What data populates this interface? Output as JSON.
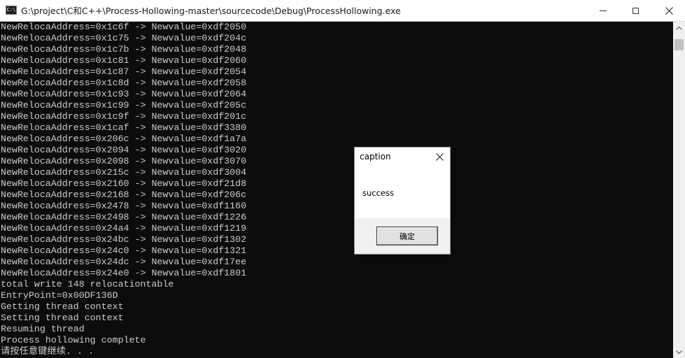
{
  "window": {
    "title": "G:\\project\\C和C++\\Process-Hollowing-master\\sourcecode\\Debug\\ProcessHollowing.exe",
    "icon": "console-app-icon",
    "icon_text": "C:\\"
  },
  "console": {
    "lines": [
      "NewRelocaAddress=0x1c6f -> Newvalue=0xdf2050",
      "NewRelocaAddress=0x1c75 -> Newvalue=0xdf204c",
      "NewRelocaAddress=0x1c7b -> Newvalue=0xdf2048",
      "NewRelocaAddress=0x1c81 -> Newvalue=0xdf2060",
      "NewRelocaAddress=0x1c87 -> Newvalue=0xdf2054",
      "NewRelocaAddress=0x1c8d -> Newvalue=0xdf2058",
      "NewRelocaAddress=0x1c93 -> Newvalue=0xdf2064",
      "NewRelocaAddress=0x1c99 -> Newvalue=0xdf205c",
      "NewRelocaAddress=0x1c9f -> Newvalue=0xdf201c",
      "NewRelocaAddress=0x1caf -> Newvalue=0xdf3380",
      "NewRelocaAddress=0x206c -> Newvalue=0xdf1a7a",
      "NewRelocaAddress=0x2094 -> Newvalue=0xdf3020",
      "NewRelocaAddress=0x2098 -> Newvalue=0xdf3070",
      "NewRelocaAddress=0x215c -> Newvalue=0xdf3004",
      "NewRelocaAddress=0x2160 -> Newvalue=0xdf21d8",
      "NewRelocaAddress=0x2168 -> Newvalue=0xdf206c",
      "NewRelocaAddress=0x2478 -> Newvalue=0xdf1160",
      "NewRelocaAddress=0x2498 -> Newvalue=0xdf1226",
      "NewRelocaAddress=0x24a4 -> Newvalue=0xdf1219",
      "NewRelocaAddress=0x24bc -> Newvalue=0xdf1302",
      "NewRelocaAddress=0x24c0 -> Newvalue=0xdf1321",
      "NewRelocaAddress=0x24dc -> Newvalue=0xdf17ee",
      "NewRelocaAddress=0x24e0 -> Newvalue=0xdf1801",
      "total write 148 relocationtable",
      "EntryPoint=0x00DF136D",
      "Getting thread context",
      "Setting thread context",
      "Resuming thread",
      "Process hollowing complete",
      "请按任意键继续. . ."
    ]
  },
  "dialog": {
    "caption": "caption",
    "message": "success",
    "ok_label": "确定"
  },
  "colors": {
    "console_bg": "#0c0c0c",
    "console_fg": "#cccccc",
    "titlebar_bg": "#ffffff"
  }
}
